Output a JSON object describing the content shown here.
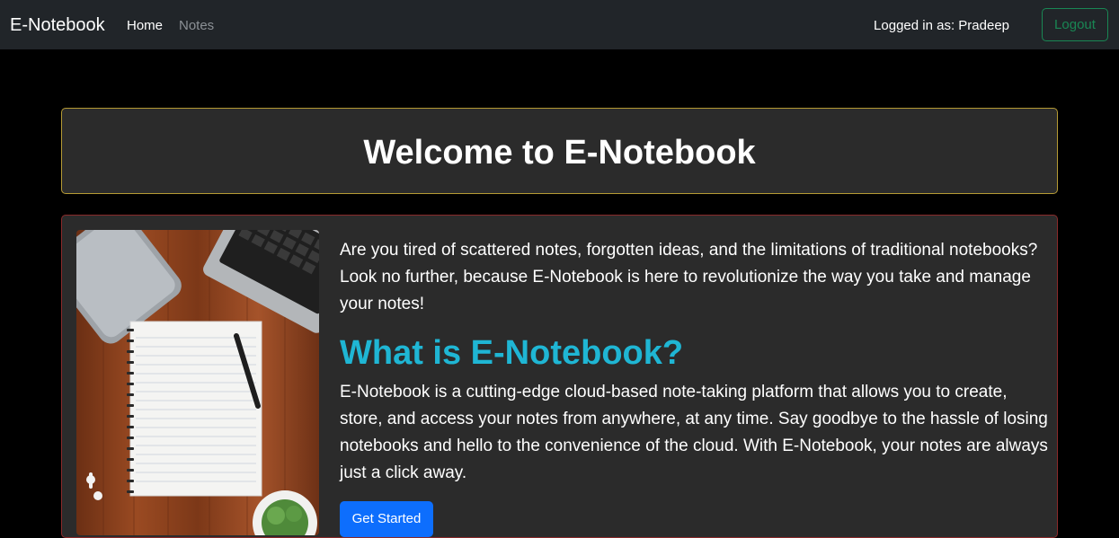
{
  "navbar": {
    "brand": "E-Notebook",
    "links": [
      {
        "label": "Home"
      },
      {
        "label": "Notes"
      }
    ],
    "logged_in_text": "Logged in as: Pradeep",
    "logout_label": "Logout"
  },
  "welcome": {
    "title": "Welcome to E-Notebook"
  },
  "about": {
    "intro": "Are you tired of scattered notes, forgotten ideas, and the limitations of traditional notebooks? Look no further, because E-Notebook is here to revolutionize the way you take and manage your notes!",
    "heading": "What is E-Notebook?",
    "description": "E-Notebook is a cutting-edge cloud-based note-taking platform that allows you to create, store, and access your notes from anywhere, at any time. Say goodbye to the hassle of losing notebooks and hello to the convenience of the cloud. With E-Notebook, your notes are always just a click away.",
    "cta_label": "Get Started"
  },
  "colors": {
    "navbar_bg": "#212529",
    "page_bg": "#000000",
    "card_bg": "#2b2b2b",
    "welcome_border": "#b59a34",
    "info_border": "#8a2a2a",
    "heading_accent": "#1fb6d4",
    "logout_green": "#198754",
    "cta_blue": "#0d6efd"
  }
}
